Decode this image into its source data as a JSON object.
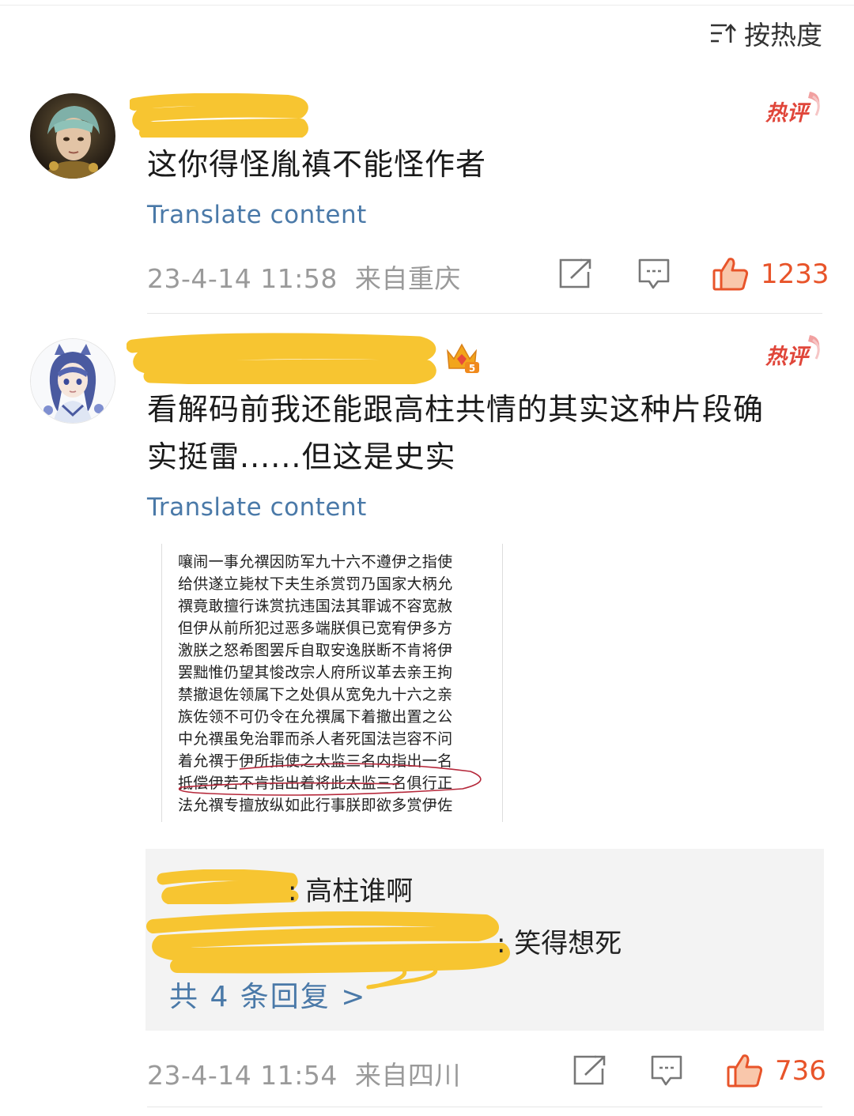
{
  "sort": {
    "label": "按热度",
    "icon": "sort-icon"
  },
  "comments": [
    {
      "badge": "热评",
      "text": "这你得怪胤禛不能怪作者",
      "translate": "Translate content",
      "time": "23-4-14 11:58",
      "location": "来自重庆",
      "likes": "1233"
    },
    {
      "badge": "热评",
      "vip_level": "5",
      "text_line1": "看解码前我还能跟高柱共情的其实这种片段确",
      "text_line2": "实挺雷......但这是史实",
      "translate": "Translate content",
      "document_lines": [
        "嚷闹一事允禩因防军九十六不遵伊之指使",
        "给供遂立毙杖下夫生杀赏罚乃国家大柄允",
        "禩竟敢擅行诛赏抗违国法其罪诚不容宽赦",
        "但伊从前所犯过恶多端朕俱已宽宥伊多方",
        "激朕之怒希图罢斥自取安逸朕断不肯将伊",
        "罢黜惟仍望其悛改宗人府所议革去亲王拘",
        "禁撤退佐领属下之处俱从宽免九十六之亲",
        "族佐领不可仍令在允禩属下着撤出置之公",
        "中允禩虽免治罪而杀人者死国法岂容不问",
        "着允禩于伊所指使之太监三名内指出一名",
        "抵偿伊若不肯指出着将此太监三名俱行正",
        "法允禩专擅放纵如此行事朕即欲多赏伊佐"
      ],
      "replies": [
        {
          "text": ": 高柱谁啊"
        },
        {
          "text": ": 笑得想死"
        }
      ],
      "more_replies": "共 4 条回复 >",
      "time": "23-4-14 11:54",
      "location": "来自四川",
      "likes": "736"
    }
  ],
  "colors": {
    "link": "#4a79a8",
    "like": "#e8542a",
    "hot_badge": "#e0463a",
    "redaction": "#f7c531"
  }
}
